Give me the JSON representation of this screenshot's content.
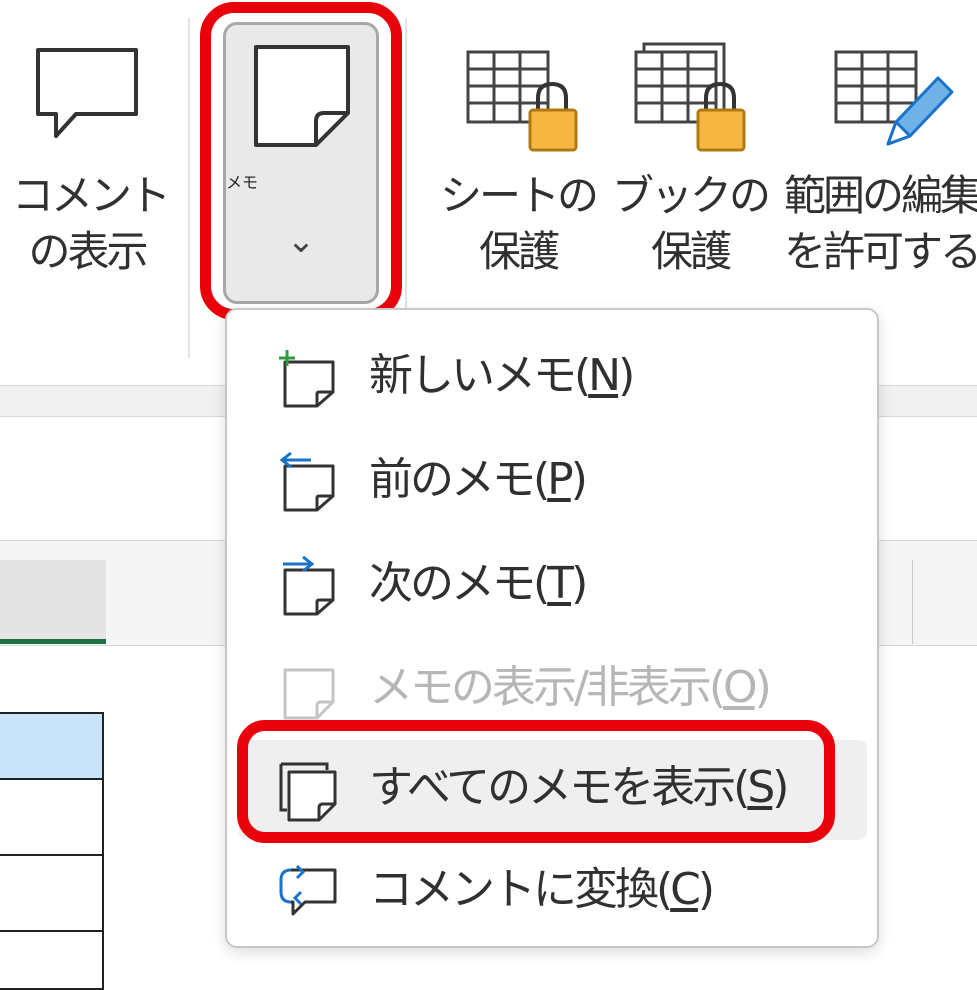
{
  "ribbon": {
    "buttons": {
      "show_comments": {
        "line1": "コメント",
        "line2": "の表示",
        "icon": "comment-bubble-icon"
      },
      "memo": {
        "label": "メモ",
        "chevron": "⌄",
        "icon": "note-icon"
      },
      "protect_sheet": {
        "line1": "シートの",
        "line2": "保護",
        "icon": "sheet-lock-icon"
      },
      "protect_workbook": {
        "line1": "ブックの",
        "line2": "保護",
        "icon": "workbook-lock-icon"
      },
      "allow_edit_ranges": {
        "line1": "範囲の編集",
        "line2": "を許可する",
        "icon": "table-pencil-icon"
      }
    }
  },
  "menu": {
    "items": [
      {
        "id": "new-memo",
        "label": "新しいメモ(",
        "key": "N",
        "suffix": ")",
        "icon": "new-note-icon",
        "enabled": true
      },
      {
        "id": "previous-memo",
        "label": "前のメモ(",
        "key": "P",
        "suffix": ")",
        "icon": "previous-note-icon",
        "enabled": true
      },
      {
        "id": "next-memo",
        "label": "次のメモ(",
        "key": "T",
        "suffix": ")",
        "icon": "next-note-icon",
        "enabled": true
      },
      {
        "id": "toggle-memo",
        "label": "メモの表示/非表示(",
        "key": "O",
        "suffix": ")",
        "icon": "note-icon",
        "enabled": false
      },
      {
        "id": "show-all-memos",
        "label": "すべてのメモを表示(",
        "key": "S",
        "suffix": ")",
        "icon": "show-all-notes-icon",
        "enabled": true
      },
      {
        "id": "convert-to-comment",
        "label": "コメントに変換(",
        "key": "C",
        "suffix": ")",
        "icon": "convert-to-comment-icon",
        "enabled": true
      }
    ]
  },
  "colors": {
    "highlight": "#e8000b",
    "accent_green": "#1e7145",
    "lock_gold": "#f5b642",
    "arrow_blue": "#1a73c9",
    "plus_green": "#2e9b3c",
    "cell_selected": "#c7e3f7"
  }
}
